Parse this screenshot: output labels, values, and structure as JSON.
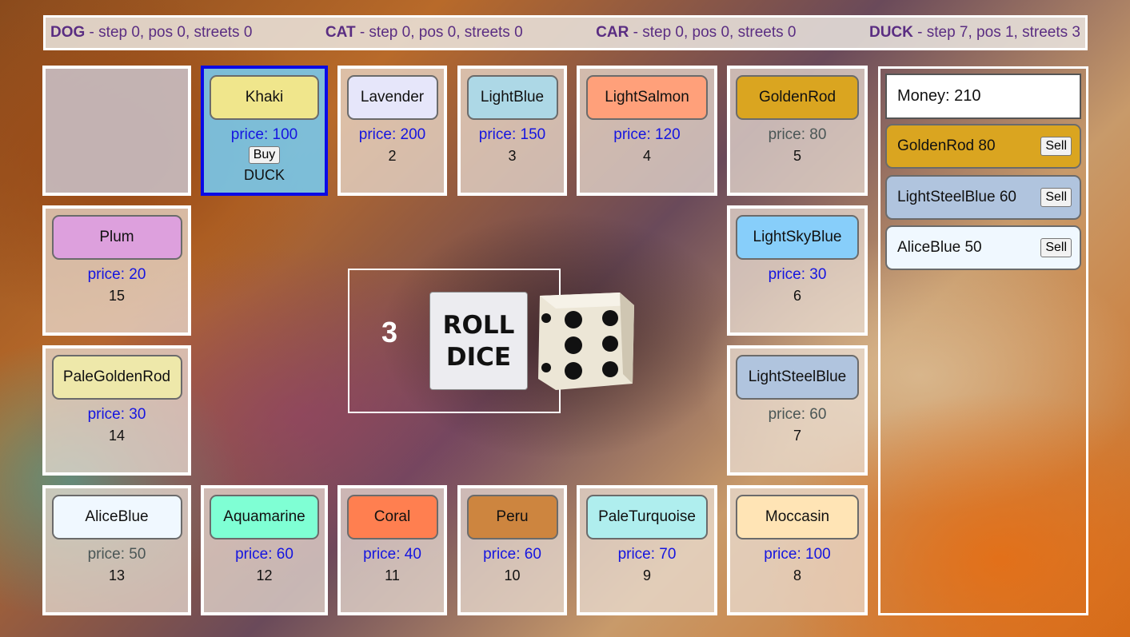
{
  "players": [
    {
      "name": "DOG",
      "info": " - step 0, pos 0, streets 0"
    },
    {
      "name": "CAT",
      "info": " - step 0, pos 0, streets 0"
    },
    {
      "name": "CAR",
      "info": " - step 0, pos 0, streets 0"
    },
    {
      "name": "DUCK",
      "info": " - step 7, pos 1, streets 3"
    }
  ],
  "cells": {
    "khaki": {
      "name": "Khaki",
      "color": "#F0E68C",
      "price": "price: 100",
      "buy": "Buy",
      "owner": "DUCK"
    },
    "lavender": {
      "name": "Lavender",
      "color": "#E6E6FA",
      "price": "price: 200",
      "num": "2"
    },
    "lightblue": {
      "name": "LightBlue",
      "color": "#ADD8E6",
      "price": "price: 150",
      "num": "3"
    },
    "lightsalmon": {
      "name": "LightSalmon",
      "color": "#FFA07A",
      "price": "price: 120",
      "num": "4"
    },
    "goldenrod": {
      "name": "GoldenRod",
      "color": "#DAA520",
      "price": "price: 80",
      "num": "5"
    },
    "lightskyblue": {
      "name": "LightSkyBlue",
      "color": "#87CEFA",
      "price": "price: 30",
      "num": "6"
    },
    "lightsteelblue": {
      "name": "LightSteelBlue",
      "color": "#B0C4DE",
      "price": "price: 60",
      "num": "7"
    },
    "moccasin": {
      "name": "Moccasin",
      "color": "#FFE4B5",
      "price": "price: 100",
      "num": "8"
    },
    "paleturquoise": {
      "name": "PaleTurquoise",
      "color": "#AFEEEE",
      "price": "price: 70",
      "num": "9"
    },
    "peru": {
      "name": "Peru",
      "color": "#CD853F",
      "price": "price: 60",
      "num": "10"
    },
    "coral": {
      "name": "Coral",
      "color": "#FF7F50",
      "price": "price: 40",
      "num": "11"
    },
    "aquamarine": {
      "name": "Aquamarine",
      "color": "#7FFFD4",
      "price": "price: 60",
      "num": "12"
    },
    "aliceblue": {
      "name": "AliceBlue",
      "color": "#F0F8FF",
      "price": "price: 50",
      "num": "13"
    },
    "palegoldenrod": {
      "name": "PaleGoldenRod",
      "color": "#EEE8AA",
      "price": "price: 30",
      "num": "14"
    },
    "plum": {
      "name": "Plum",
      "color": "#DDA0DD",
      "price": "price: 20",
      "num": "15"
    }
  },
  "dice": {
    "result": "3",
    "roll_line1": "ROLL",
    "roll_line2": "DICE"
  },
  "panel": {
    "money": "Money: 210",
    "owned": [
      {
        "label": "GoldenRod 80",
        "color": "#DAA520",
        "sell": "Sell"
      },
      {
        "label": "LightSteelBlue 60",
        "color": "#B0C4DE",
        "sell": "Sell"
      },
      {
        "label": "AliceBlue 50",
        "color": "#F0F8FF",
        "sell": "Sell"
      }
    ]
  }
}
